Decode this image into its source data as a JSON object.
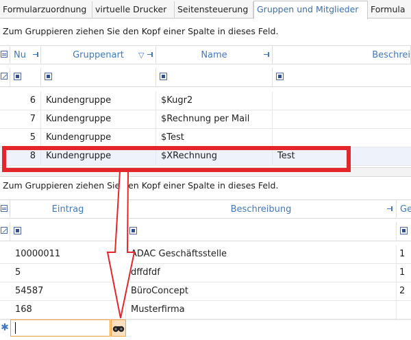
{
  "tabs": [
    {
      "label": "Formularzuordnung",
      "active": false
    },
    {
      "label": "virtuelle Drucker",
      "active": false
    },
    {
      "label": "Seitensteuerung",
      "active": false
    },
    {
      "label": "Gruppen und Mitglieder",
      "active": true
    },
    {
      "label": "Formula",
      "active": false
    }
  ],
  "top_grid": {
    "group_hint": "Zum Gruppieren ziehen Sie den Kopf einer Spalte in dieses Feld.",
    "columns": [
      "Nu",
      "Gruppenart",
      "Name",
      "Beschrei"
    ],
    "rows": [
      {
        "nr": "6",
        "gruppenart": "Kundengruppe",
        "name": "$Kugr2",
        "beschreibung": ""
      },
      {
        "nr": "7",
        "gruppenart": "Kundengruppe",
        "name": "$Rechnung per Mail",
        "beschreibung": ""
      },
      {
        "nr": "5",
        "gruppenart": "Kundengruppe",
        "name": "$Test",
        "beschreibung": ""
      },
      {
        "nr": "8",
        "gruppenart": "Kundengruppe",
        "name": "$XRechnung",
        "beschreibung": "Test"
      }
    ]
  },
  "bottom_grid": {
    "group_hint": "Zum Gruppieren ziehen Sie den Kopf einer Spalte in dieses Feld.",
    "columns": [
      "Eintrag",
      "Beschreibung",
      "Ge"
    ],
    "rows": [
      {
        "eintrag": "10000011",
        "beschreibung": "ADAC Geschäftsstelle",
        "extra": "1"
      },
      {
        "eintrag": "5",
        "beschreibung": "dffdfdf",
        "extra": "1"
      },
      {
        "eintrag": "54587",
        "beschreibung": "BüroConcept",
        "extra": "2"
      },
      {
        "eintrag": "168",
        "beschreibung": "Musterfirma",
        "extra": ""
      }
    ],
    "new_row_value": ""
  },
  "colors": {
    "accent": "#3f78c2",
    "highlight": "#e4262b",
    "arrow": "#e4262b",
    "input_border": "#f0a040"
  }
}
